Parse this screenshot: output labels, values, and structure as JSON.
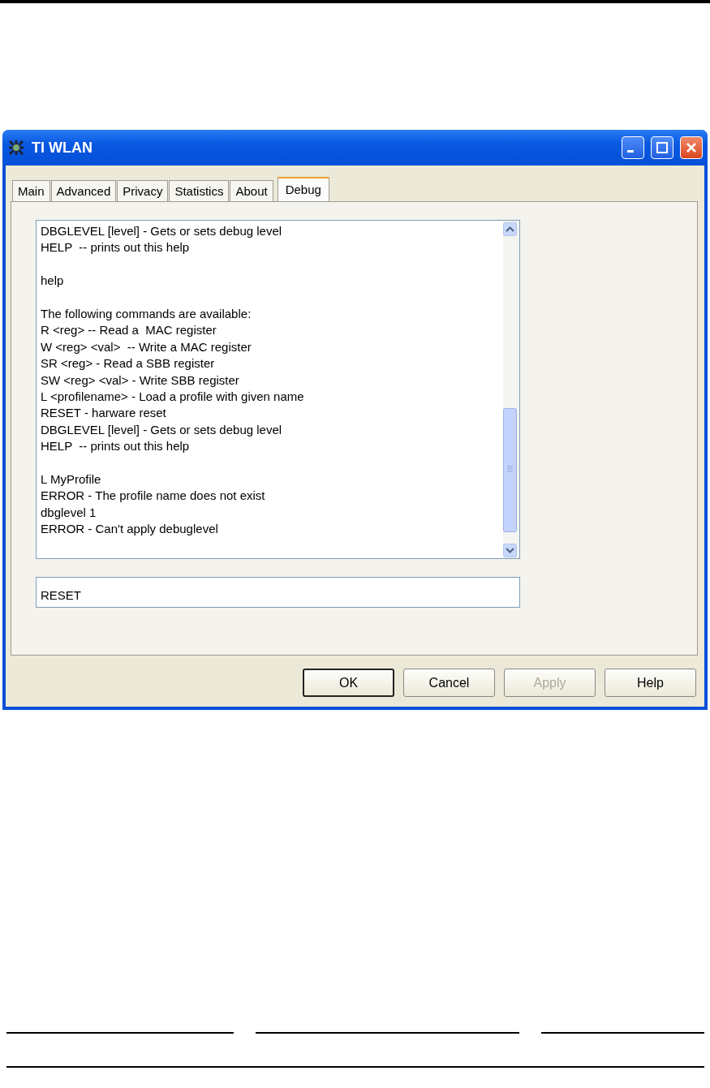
{
  "window": {
    "title": "TI WLAN"
  },
  "tabs": [
    {
      "label": "Main",
      "selected": false
    },
    {
      "label": "Advanced",
      "selected": false
    },
    {
      "label": "Privacy",
      "selected": false
    },
    {
      "label": "Statistics",
      "selected": false
    },
    {
      "label": "About",
      "selected": false
    },
    {
      "label": "Debug",
      "selected": true
    }
  ],
  "log": [
    {
      "lines": [
        "DBGLEVEL [level] - Gets or sets debug level",
        "HELP  -- prints out this help"
      ]
    },
    {
      "lines": [
        "help"
      ]
    },
    {
      "lines": [
        "The following commands are available:",
        "R <reg> -- Read a  MAC register",
        "W <reg> <val>  -- Write a MAC register",
        "SR <reg> - Read a SBB register",
        "SW <reg> <val> - Write SBB register",
        "L <profilename> - Load a profile with given name",
        "RESET - harware reset",
        "DBGLEVEL [level] - Gets or sets debug level",
        "HELP  -- prints out this help"
      ]
    },
    {
      "lines": [
        "L MyProfile",
        "ERROR - The profile name does not exist",
        "dbglevel 1",
        "ERROR - Can't apply debuglevel"
      ]
    }
  ],
  "command": {
    "value": "RESET"
  },
  "buttons": [
    {
      "label": "OK",
      "default": true,
      "disabled": false
    },
    {
      "label": "Cancel",
      "default": false,
      "disabled": false
    },
    {
      "label": "Apply",
      "default": false,
      "disabled": true
    },
    {
      "label": "Help",
      "default": false,
      "disabled": false
    }
  ]
}
